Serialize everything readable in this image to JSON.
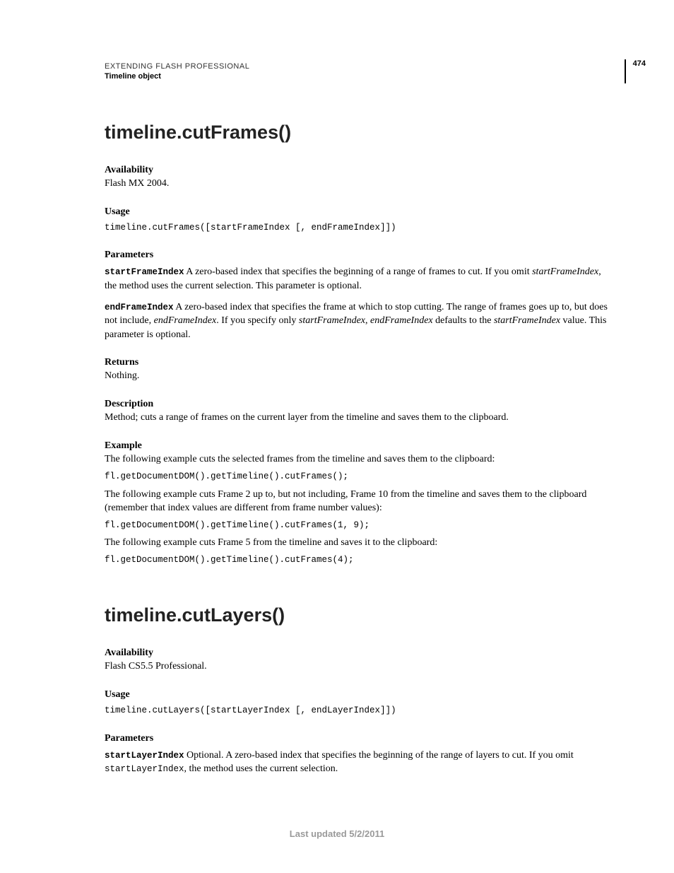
{
  "header": {
    "title": "EXTENDING FLASH PROFESSIONAL",
    "subtitle": "Timeline object",
    "pageNumber": "474"
  },
  "section1": {
    "title": "timeline.cutFrames()",
    "availabilityLabel": "Availability",
    "availabilityText": "Flash MX 2004.",
    "usageLabel": "Usage",
    "usageCode": "timeline.cutFrames([startFrameIndex [, endFrameIndex]])",
    "parametersLabel": "Parameters",
    "param1Name": "startFrameIndex",
    "param1TextA": "  A zero-based index that specifies the beginning of a range of frames to cut. If you omit ",
    "param1Ital": "startFrameIndex",
    "param1TextB": ", the method uses the current selection. This parameter is optional.",
    "param2Name": "endFrameIndex",
    "param2TextA": "  A zero-based index that specifies the frame at which to stop cutting. The range of frames goes up to, but does not include, ",
    "param2ItalA": "endFrameIndex",
    "param2TextB": ". If you specify only ",
    "param2ItalB": "startFrameIndex",
    "param2TextC": ", ",
    "param2ItalC": "endFrameIndex",
    "param2TextD": " defaults to the ",
    "param2ItalD": "startFrameIndex",
    "param2TextE": " value. This parameter is optional.",
    "returnsLabel": "Returns",
    "returnsText": "Nothing.",
    "descriptionLabel": "Description",
    "descriptionText": "Method; cuts a range of frames on the current layer from the timeline and saves them to the clipboard.",
    "exampleLabel": "Example",
    "example1Text": "The following example cuts the selected frames from the timeline and saves them to the clipboard:",
    "example1Code": "fl.getDocumentDOM().getTimeline().cutFrames();",
    "example2Text": "The following example cuts Frame 2 up to, but not including, Frame 10 from the timeline and saves them to the clipboard (remember that index values are different from frame number values):",
    "example2Code": "fl.getDocumentDOM().getTimeline().cutFrames(1, 9);",
    "example3Text": "The following example cuts Frame 5 from the timeline and saves it to the clipboard:",
    "example3Code": "fl.getDocumentDOM().getTimeline().cutFrames(4);"
  },
  "section2": {
    "title": "timeline.cutLayers()",
    "availabilityLabel": "Availability",
    "availabilityText": "Flash CS5.5 Professional.",
    "usageLabel": "Usage",
    "usageCode": "timeline.cutLayers([startLayerIndex [, endLayerIndex]])",
    "parametersLabel": "Parameters",
    "param1Name": "startLayerIndex",
    "param1TextA": "  Optional. A zero-based index that specifies the beginning of the range of layers to cut. If you omit ",
    "param1Code": "startLayerIndex",
    "param1TextB": ", the method uses the current selection."
  },
  "footer": "Last updated 5/2/2011"
}
